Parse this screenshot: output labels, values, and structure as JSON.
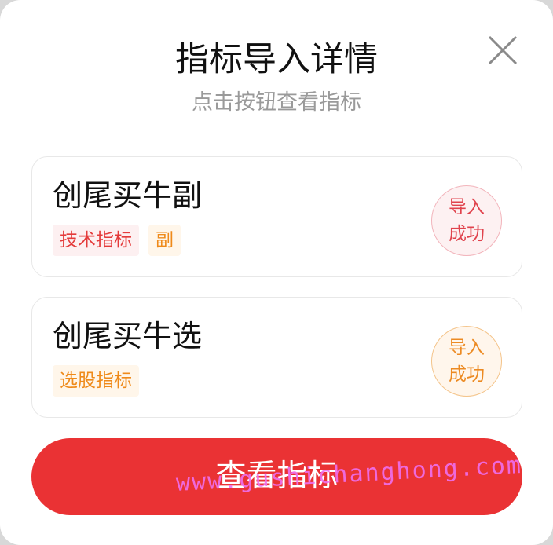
{
  "dialog": {
    "title": "指标导入详情",
    "subtitle": "点击按钮查看指标",
    "close_icon": "close-icon"
  },
  "cards": [
    {
      "name": "创尾买牛副",
      "tags": [
        {
          "label": "技术指标",
          "color": "#e43b3b"
        },
        {
          "label": "副",
          "color": "#ef8a1a"
        }
      ],
      "status_line1": "导入",
      "status_line2": "成功",
      "status_color": "#e0434d"
    },
    {
      "name": "创尾买牛选",
      "tags": [
        {
          "label": "选股指标",
          "color": "#ef8a1a"
        }
      ],
      "status_line1": "导入",
      "status_line2": "成功",
      "status_color": "#ec8a22"
    }
  ],
  "action": {
    "label": "查看指标",
    "color": "#ea3234"
  },
  "watermark": "www.gushichanghong.com"
}
